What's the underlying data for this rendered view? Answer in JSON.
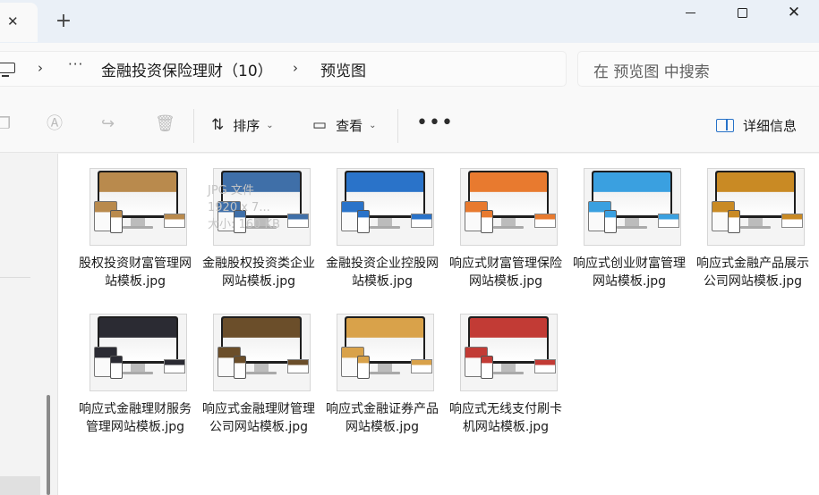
{
  "tabs": {
    "close_glyph": "✕",
    "new_tab_glyph": "+"
  },
  "window": {
    "close_glyph": "✕"
  },
  "address": {
    "separator": "›",
    "overflow": "···",
    "crumbs": [
      "金融投资保险理财（10）",
      "预览图"
    ]
  },
  "search": {
    "placeholder": "在 预览图 中搜索"
  },
  "toolbar": {
    "sort_label": "排序",
    "view_label": "查看",
    "more_label": "•••",
    "details_label": "详细信息",
    "chevron": "⌄"
  },
  "ghost_info": {
    "line1": "JPG 文件",
    "line2": "1920 x 7...",
    "line3": "大小: 160 KB"
  },
  "files": [
    {
      "name": "股权投资财富管理网站模板.jpg",
      "accent": "#b98a4d"
    },
    {
      "name": "金融股权投资类企业网站模板.jpg",
      "accent": "#3f6fa8"
    },
    {
      "name": "金融投资企业控股网站模板.jpg",
      "accent": "#2a73c9"
    },
    {
      "name": "响应式财富管理保险网站模板.jpg",
      "accent": "#e87a2f"
    },
    {
      "name": "响应式创业财富管理网站模板.jpg",
      "accent": "#3aa0e0"
    },
    {
      "name": "响应式金融产品展示公司网站模板.jpg",
      "accent": "#c98a24"
    },
    {
      "name": "响应式金融理财服务管理网站模板.jpg",
      "accent": "#2b2b33"
    },
    {
      "name": "响应式金融理财管理公司网站模板.jpg",
      "accent": "#6b4e2a"
    },
    {
      "name": "响应式金融证券产品网站模板.jpg",
      "accent": "#d9a24a"
    },
    {
      "name": "响应式无线支付刷卡机网站模板.jpg",
      "accent": "#c23b35"
    }
  ]
}
